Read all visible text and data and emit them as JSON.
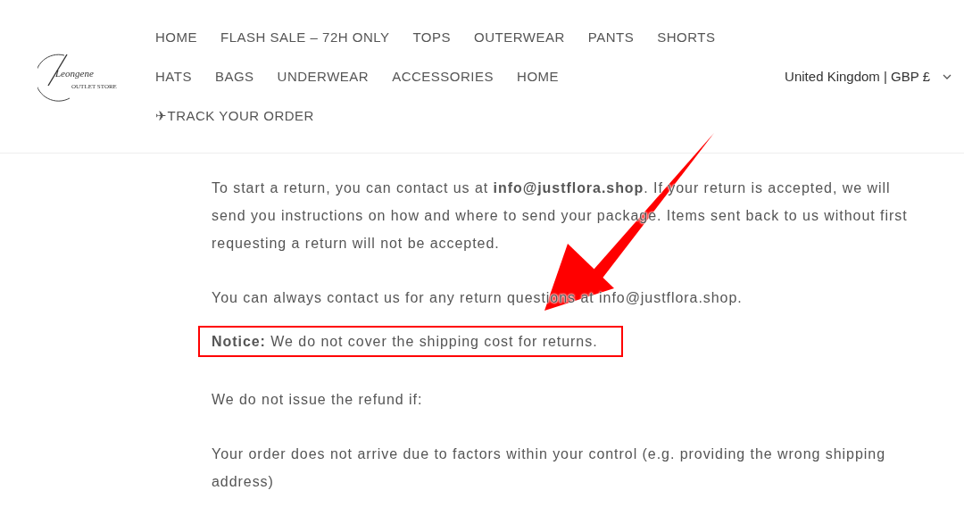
{
  "logo": {
    "name": "Leongene",
    "tagline": "OUTLET STORE"
  },
  "nav_rows": [
    [
      "HOME",
      "FLASH SALE – 72H ONLY",
      "TOPS",
      "OUTERWEAR",
      "PANTS",
      "SHORTS"
    ],
    [
      "HATS",
      "BAGS",
      "UNDERWEAR",
      "ACCESSORIES",
      "HOME"
    ],
    [
      "✈TRACK YOUR ORDER"
    ]
  ],
  "region_selector": {
    "label": "United Kingdom | GBP £"
  },
  "paragraphs": [
    {
      "text": "To start a return, you can contact us at **info@justflora.shop**. If your return is accepted, we will send you instructions on how and where to send your package. Items sent back to us without first requesting a return will not be accepted.",
      "highlighted": false
    },
    {
      "text": "You can always contact us for any return questions at info@justflora.shop.",
      "highlighted": false
    },
    {
      "text": "**Notice:** We do not cover the shipping cost for returns.",
      "highlighted": true
    },
    {
      "text": "We do not issue the refund if:",
      "highlighted": false
    },
    {
      "text": "Your order does not arrive due to factors within your control (e.g. providing the wrong shipping address)",
      "highlighted": false
    }
  ]
}
